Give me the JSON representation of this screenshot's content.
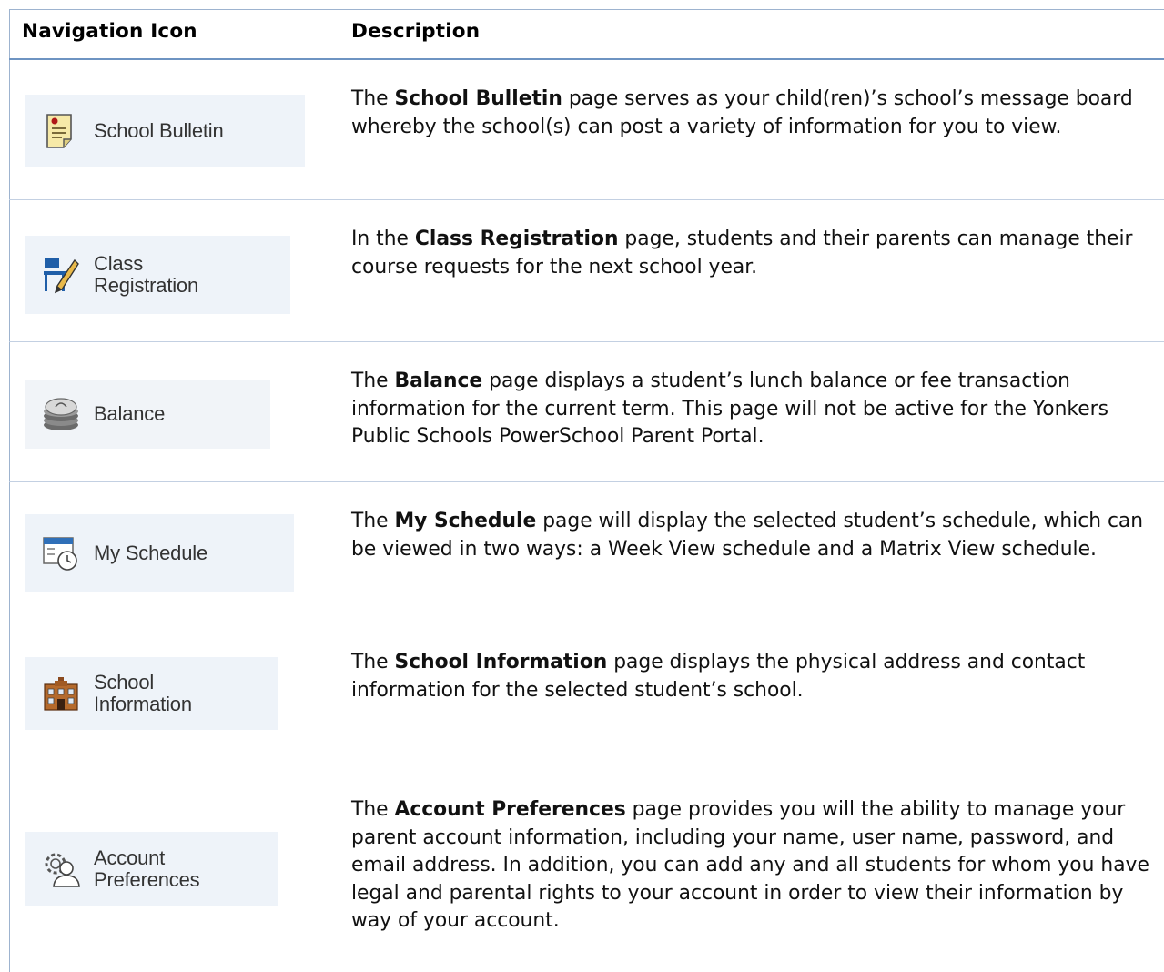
{
  "header": {
    "col1": "Navigation Icon",
    "col2": "Description"
  },
  "rows": [
    {
      "icon": "bulletin-icon",
      "label": "School Bulletin",
      "pre": "The ",
      "bold": "School Bulletin",
      "post": " page serves as your child(ren)’s school’s message board whereby the school(s) can post a variety of information for you to view."
    },
    {
      "icon": "class-registration-icon",
      "label": "Class\nRegistration",
      "pre": "In the ",
      "bold": "Class Registration",
      "post": " page, students and their parents can manage their course requests for the next school year."
    },
    {
      "icon": "coins-icon",
      "label": "Balance",
      "pre": "The ",
      "bold": "Balance",
      "post": " page displays a student’s lunch balance or fee transaction information for the current term.  This page will not be active for the Yonkers Public Schools PowerSchool Parent Portal."
    },
    {
      "icon": "calendar-clock-icon",
      "label": "My Schedule",
      "pre": "The ",
      "bold": "My Schedule",
      "post": " page will display the selected student’s schedule, which can be viewed in two ways: a Week View schedule and a Matrix View schedule."
    },
    {
      "icon": "school-building-icon",
      "label": "School\nInformation",
      "pre": "The ",
      "bold": "School Information",
      "post": " page displays the physical address and contact information for the selected student’s school."
    },
    {
      "icon": "account-gear-icon",
      "label": "Account\nPreferences",
      "pre": "The ",
      "bold": "Account Preferences",
      "post": " page provides you will the ability to manage your parent account information, including your name, user name, password, and email address. In addition, you can add any and all students for whom you have legal and parental rights to your account in order to view their information by way of your account."
    }
  ]
}
